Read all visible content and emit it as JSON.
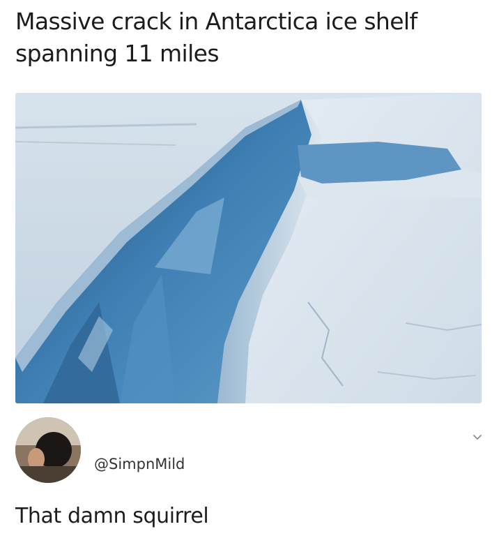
{
  "post": {
    "title_line1": "Massive crack in Antarctica ice shelf",
    "title_line2": "spanning 11 miles"
  },
  "image": {
    "subject": "ice-shelf-crack-photo"
  },
  "reply": {
    "avatar_icon": "user-avatar-photo",
    "handle": "@SimpnMild",
    "text": "That damn squirrel",
    "menu_icon": "chevron-down-icon"
  }
}
